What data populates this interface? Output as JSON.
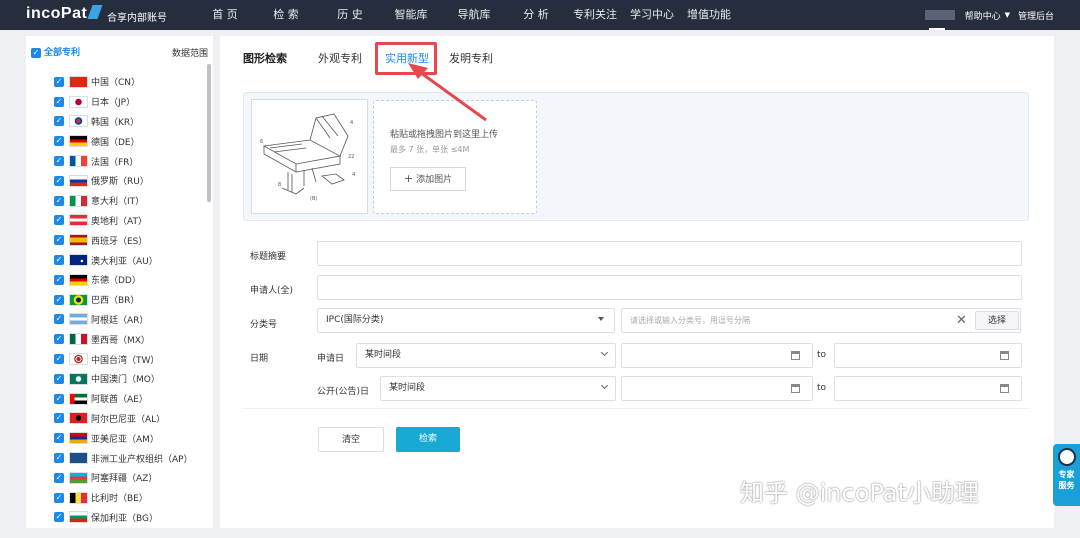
{
  "nav": {
    "logo": "incoPat",
    "org": "合享内部账号",
    "menu": [
      "首 页",
      "检 索",
      "历 史",
      "智能库",
      "导航库",
      "分 析",
      "专利关注",
      "学习中心",
      "增值功能"
    ],
    "help": "帮助中心",
    "admin": "管理后台"
  },
  "sidebar": {
    "all_label": "全部专利",
    "range_label": "数据范围",
    "items": [
      "中国（CN）",
      "日本（JP）",
      "韩国（KR）",
      "德国（DE）",
      "法国（FR）",
      "俄罗斯（RU）",
      "意大利（IT）",
      "奥地利（AT）",
      "西班牙（ES）",
      "澳大利亚（AU）",
      "东德（DD）",
      "巴西（BR）",
      "阿根廷（AR）",
      "墨西哥（MX）",
      "中国台湾（TW）",
      "中国澳门（MO）",
      "阿联酋（AE）",
      "阿尔巴尼亚（AL）",
      "亚美尼亚（AM）",
      "非洲工业产权组织（AP）",
      "阿塞拜疆（AZ）",
      "比利时（BE）",
      "保加利亚（BG）"
    ]
  },
  "main": {
    "title": "图形检索",
    "tabs": [
      "外观专利",
      "实用新型",
      "发明专利"
    ],
    "active_tab": "实用新型",
    "upload": {
      "hint": "粘贴或拖拽图片到这里上传",
      "limit": "最多 7 张，单张 ≤4M",
      "add_label": "添加图片"
    },
    "form": {
      "title_label": "标题摘要",
      "applicant_label": "申请人(全)",
      "class_label": "分类号",
      "class_select": "IPC(国际分类)",
      "class_placeholder": "请选择或输入分类号，用逗号分隔",
      "choose_label": "选择",
      "date_label": "日期",
      "apply_date_label": "申请日",
      "pub_date_label": "公开(公告)日",
      "period_value": "某时间段",
      "to_label": "to"
    },
    "clear_label": "清空",
    "search_label": "检索"
  },
  "watermark": "知乎 @incoPat小助理",
  "expert": "专家服务",
  "colors": {
    "nav_bg": "#252e3d",
    "accent": "#1e88e5",
    "primary_button": "#18a9d4",
    "highlight": "#e5484d"
  }
}
